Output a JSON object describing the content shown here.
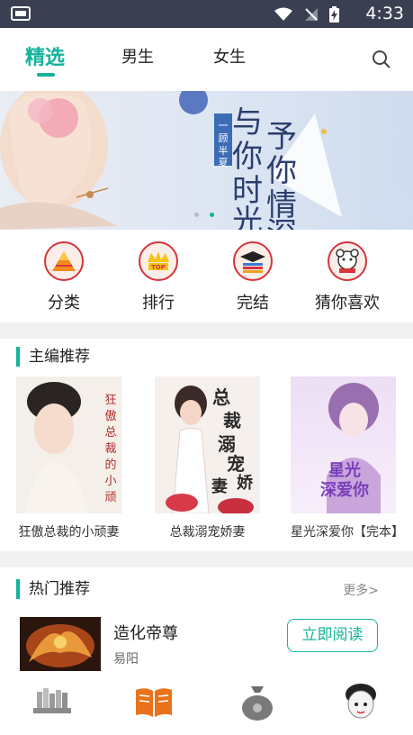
{
  "status_bar": {
    "time": "4:33"
  },
  "top_tabs": [
    {
      "label": "精选",
      "active": true
    },
    {
      "label": "男生",
      "active": false
    },
    {
      "label": "女生",
      "active": false
    }
  ],
  "banner": {
    "author_badge": "一顾半夏",
    "book_title": "与你时光 予你情深",
    "slide_count": 2,
    "active_slide": 2
  },
  "categories": [
    {
      "label": "分类",
      "icon": "pyramid-icon"
    },
    {
      "label": "排行",
      "icon": "crown-top-icon"
    },
    {
      "label": "完结",
      "icon": "books-cap-icon"
    },
    {
      "label": "猜你喜欢",
      "icon": "mascot-icon"
    }
  ],
  "editor_pick": {
    "title": "主编推荐",
    "books": [
      {
        "title": "狂傲总裁的小顽妻"
      },
      {
        "title": "总裁溺宠娇妻"
      },
      {
        "title": "星光深爱你【完本】"
      }
    ]
  },
  "hot": {
    "title": "热门推荐",
    "more_label": "更多>",
    "items": [
      {
        "name": "造化帝尊",
        "author": "易阳",
        "button": "立即阅读"
      }
    ]
  },
  "bottom_nav": [
    {
      "icon": "bookshelf-icon"
    },
    {
      "icon": "open-book-icon"
    },
    {
      "icon": "money-bag-icon"
    },
    {
      "icon": "profile-avatar-icon"
    }
  ],
  "colors": {
    "accent": "#14b39b",
    "status_bar": "#3a3f51",
    "divider": "#f1f1f1"
  }
}
